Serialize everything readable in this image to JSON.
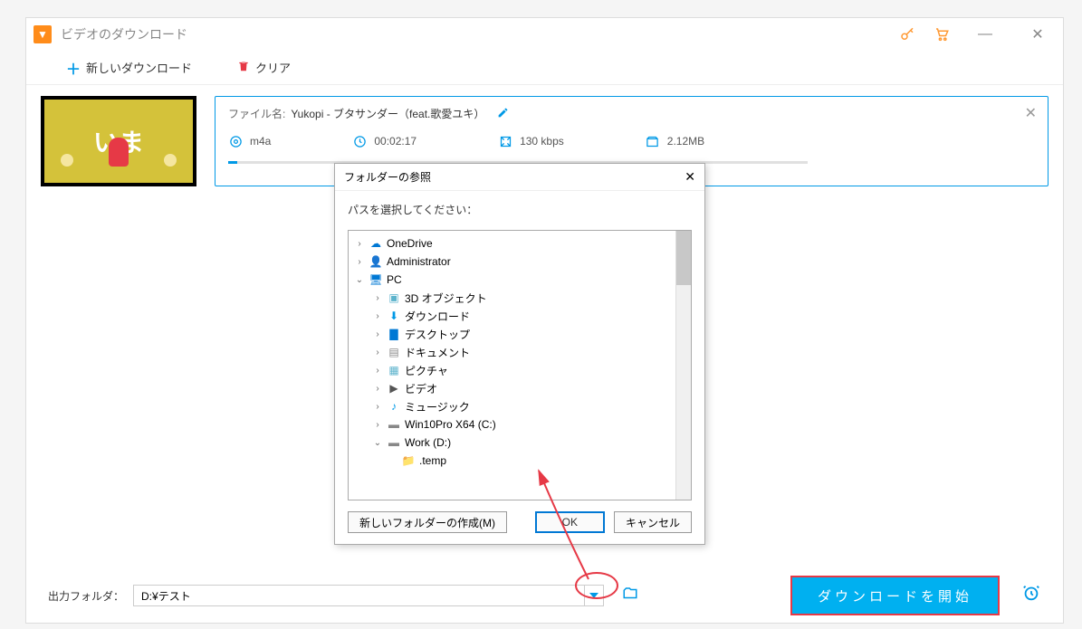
{
  "app": {
    "title": "ビデオのダウンロード"
  },
  "toolbar": {
    "newDownload": "新しいダウンロード",
    "clear": "クリア"
  },
  "card": {
    "filenameLabel": "ファイル名:",
    "filename": "Yukopi - ブタサンダー（feat.歌愛ユキ）",
    "format": "m4a",
    "duration": "00:02:17",
    "bitrate": "130 kbps",
    "size": "2.12MB",
    "thumbText": "いま"
  },
  "dialog": {
    "title": "フォルダーの参照",
    "prompt": "パスを選択してください：",
    "newFolder": "新しいフォルダーの作成(M)",
    "ok": "OK",
    "cancel": "キャンセル",
    "tree": {
      "onedrive": "OneDrive",
      "admin": "Administrator",
      "pc": "PC",
      "obj3d": "3D オブジェクト",
      "downloads": "ダウンロード",
      "desktop": "デスクトップ",
      "documents": "ドキュメント",
      "pictures": "ピクチャ",
      "videos": "ビデオ",
      "music": "ミュージック",
      "drivec": "Win10Pro X64 (C:)",
      "drived": "Work (D:)",
      "temp": ".temp"
    }
  },
  "bottom": {
    "outputLabel": "出力フォルダ：",
    "outputPath": "D:¥テスト",
    "startDownload": "ダウンロードを開始"
  }
}
